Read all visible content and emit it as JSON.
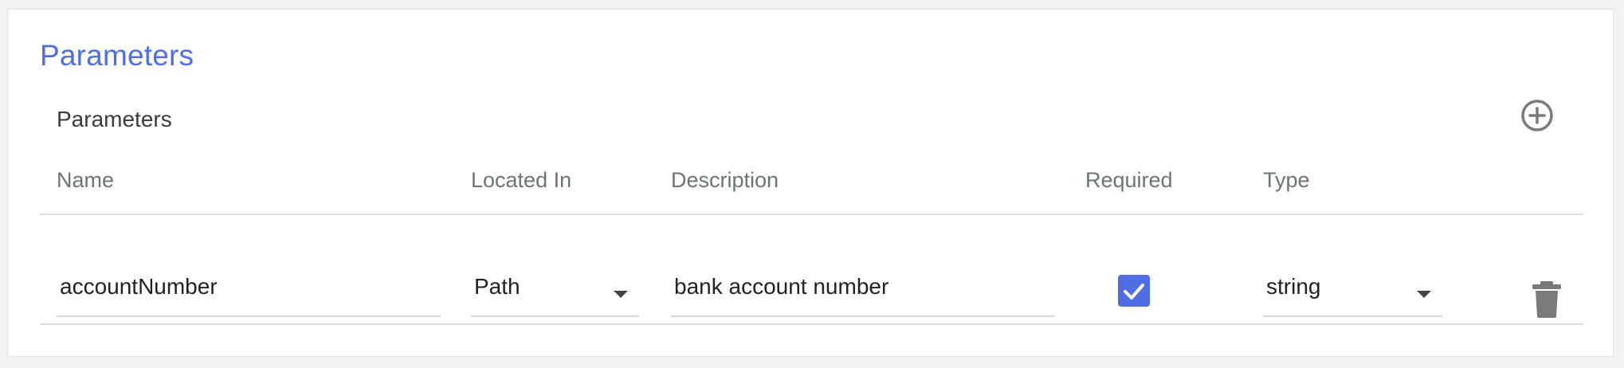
{
  "section": {
    "title": "Parameters"
  },
  "table": {
    "title": "Parameters",
    "headers": {
      "name": "Name",
      "located_in": "Located In",
      "description": "Description",
      "required": "Required",
      "type": "Type"
    },
    "rows": [
      {
        "name": "accountNumber",
        "located_in": "Path",
        "description": "bank account number",
        "required": true,
        "type": "string"
      }
    ]
  },
  "icons": {
    "add": "add-circle-icon",
    "delete": "trash-icon",
    "check": "check-icon",
    "dropdown": "caret-down-icon"
  },
  "colors": {
    "accent": "#4f6ee5",
    "header_text": "#6a7575",
    "icon_gray": "#7a7a7a"
  }
}
